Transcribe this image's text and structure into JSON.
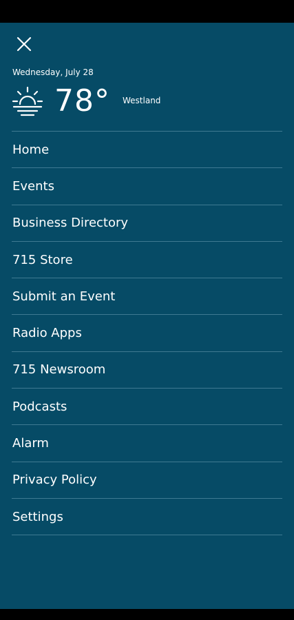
{
  "weather": {
    "date": "Wednesday, July 28",
    "temperature": "78°",
    "location": "Westland",
    "icon": "sunrise-icon"
  },
  "menu": {
    "items": [
      {
        "label": "Home"
      },
      {
        "label": "Events"
      },
      {
        "label": "Business Directory"
      },
      {
        "label": "715 Store"
      },
      {
        "label": "Submit an Event"
      },
      {
        "label": "Radio Apps"
      },
      {
        "label": "715 Newsroom"
      },
      {
        "label": "Podcasts"
      },
      {
        "label": "Alarm"
      },
      {
        "label": "Privacy Policy"
      },
      {
        "label": "Settings"
      }
    ]
  },
  "colors": {
    "drawer_background": "#064b66",
    "divider": "#3f7a92",
    "text": "#ffffff"
  }
}
